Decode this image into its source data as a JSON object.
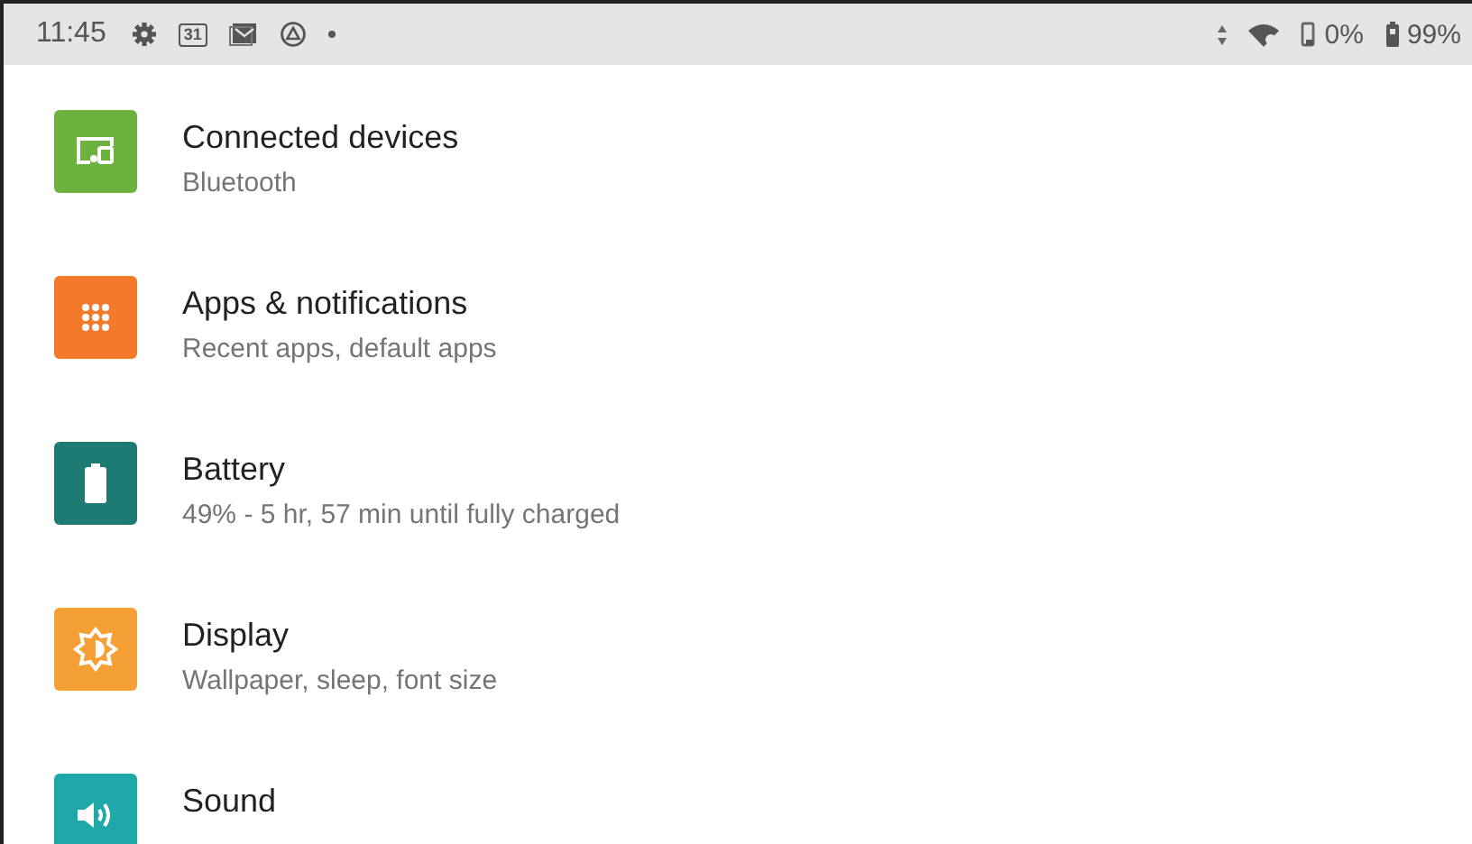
{
  "status_bar": {
    "time": "11:45",
    "calendar_day": "31",
    "signal_percent": "0%",
    "battery_percent": "99%"
  },
  "settings": [
    {
      "kind": "devices",
      "color": "#6cb33e",
      "title": "Connected devices",
      "subtitle": "Bluetooth"
    },
    {
      "kind": "apps",
      "color": "#f47a2b",
      "title": "Apps & notifications",
      "subtitle": "Recent apps, default apps"
    },
    {
      "kind": "battery",
      "color": "#1e7b74",
      "title": "Battery",
      "subtitle": "49% - 5 hr, 57 min until fully charged"
    },
    {
      "kind": "display",
      "color": "#f5a035",
      "title": "Display",
      "subtitle": "Wallpaper, sleep, font size"
    },
    {
      "kind": "sound",
      "color": "#1ea8a8",
      "title": "Sound"
    }
  ]
}
